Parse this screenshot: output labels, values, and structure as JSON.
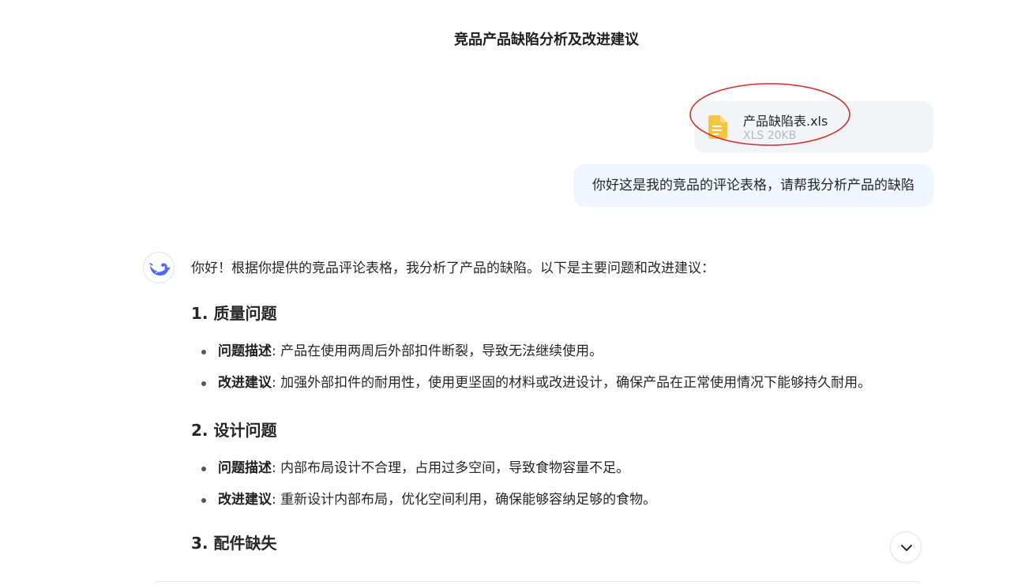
{
  "conversation": {
    "title": "竞品产品缺陷分析及改进建议"
  },
  "attachment": {
    "filename": "产品缺陷表.xls",
    "meta": "XLS 20KB",
    "icon": "spreadsheet-file-icon",
    "icon_color": "#f5c542",
    "highlight_color": "#d32f2f"
  },
  "user_message": {
    "text": "你好这是我的竞品的评论表格，请帮我分析产品的缺陷"
  },
  "assistant": {
    "avatar_icon": "whale-logo-icon",
    "accent": "#4d6bfe",
    "intro": "你好！根据你提供的竞品评论表格，我分析了产品的缺陷。以下是主要问题和改进建议：",
    "sections": [
      {
        "title": "1. 质量问题",
        "points": [
          {
            "label": "问题描述",
            "text": ": 产品在使用两周后外部扣件断裂，导致无法继续使用。"
          },
          {
            "label": "改进建议",
            "text": ": 加强外部扣件的耐用性，使用更坚固的材料或改进设计，确保产品在正常使用情况下能够持久耐用。"
          }
        ]
      },
      {
        "title": "2. 设计问题",
        "points": [
          {
            "label": "问题描述",
            "text": ": 内部布局设计不合理，占用过多空间，导致食物容量不足。"
          },
          {
            "label": "改进建议",
            "text": ": 重新设计内部布局，优化空间利用，确保能够容纳足够的食物。"
          }
        ]
      },
      {
        "title": "3. 配件缺失"
      }
    ]
  },
  "controls": {
    "scroll_down_icon": "chevron-down-icon"
  }
}
